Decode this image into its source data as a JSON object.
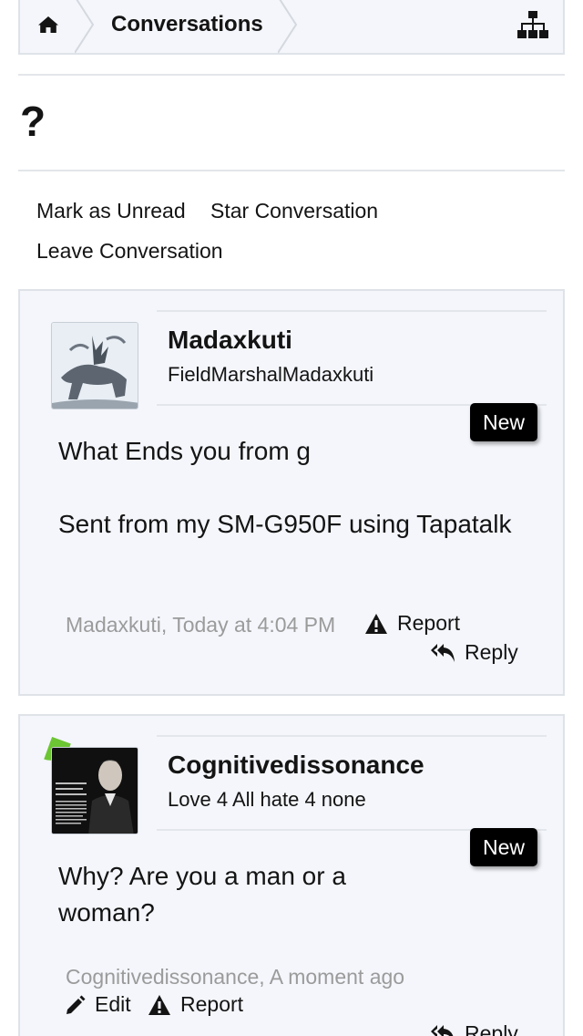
{
  "breadcrumb": {
    "home_icon": "home-icon",
    "current": "Conversations",
    "sitemap_icon": "sitemap-icon"
  },
  "page": {
    "title": "?"
  },
  "actions": {
    "mark_unread": "Mark as Unread",
    "star": "Star Conversation",
    "leave": "Leave Conversation"
  },
  "messages": [
    {
      "username": "Madaxkuti",
      "user_title": "FieldMarshalMadaxkuti",
      "badge": "New",
      "body_line1": "What Ends you from g",
      "body_line2": "Sent from my SM-G950F using Tapatalk",
      "meta": "Madaxkuti, Today at 4:04 PM",
      "report": "Report",
      "reply": "Reply"
    },
    {
      "username": "Cognitivedissonance",
      "user_title": "Love 4 All hate 4 none",
      "badge": "New",
      "body": "Why? Are you a man or a woman?",
      "meta": "Cognitivedissonance, A moment ago",
      "edit": "Edit",
      "report": "Report",
      "reply": "Reply",
      "online_color": "#6cc533"
    }
  ]
}
